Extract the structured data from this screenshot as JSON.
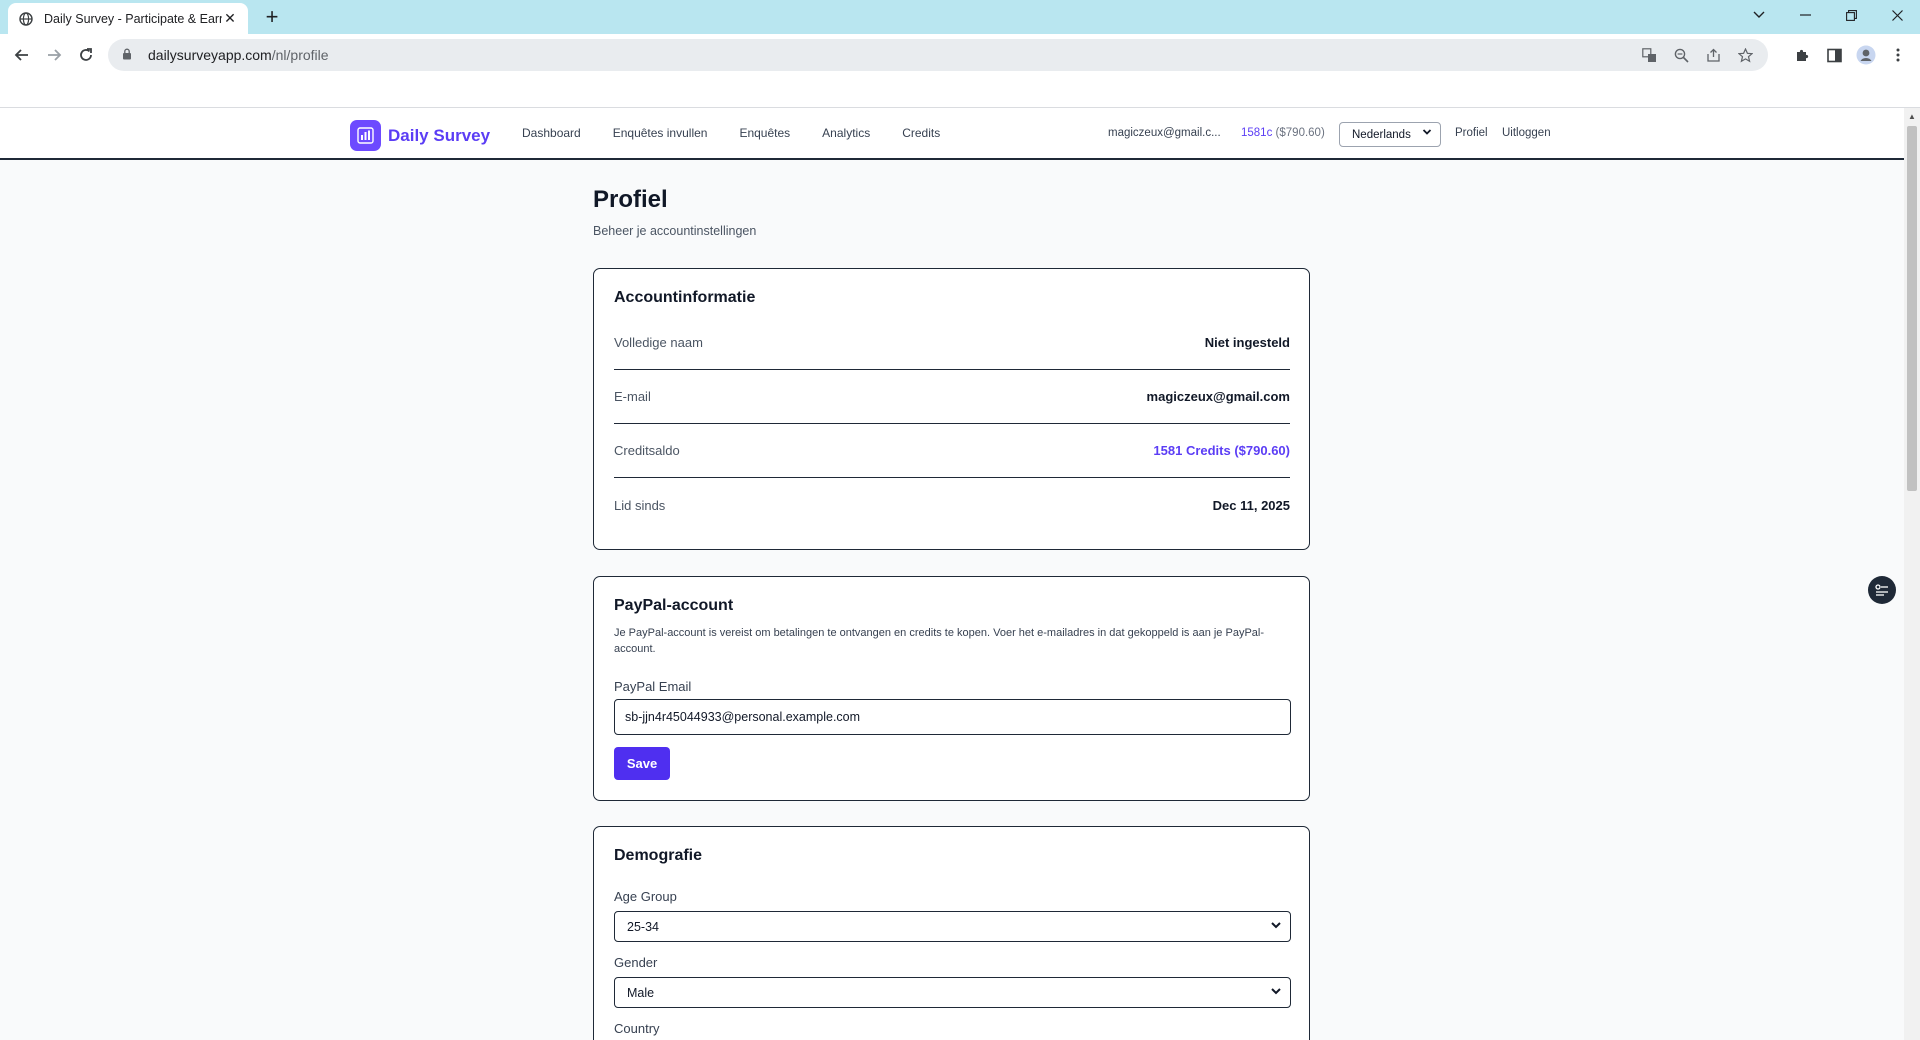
{
  "browser": {
    "tab_title": "Daily Survey - Participate & Earn",
    "tab_close": "✕",
    "new_tab": "+",
    "url_domain": "dailysurveyapp.com",
    "url_path": "/nl/profile"
  },
  "site": {
    "brand": "Daily Survey",
    "brand_color": "#5b3df5",
    "nav": [
      "Dashboard",
      "Enquêtes invullen",
      "Enquêtes",
      "Analytics",
      "Credits"
    ],
    "user_email": "magiczeux@gmail.c...",
    "credits_short": "1581c",
    "credits_usd": "($790.60)",
    "language": "Nederlands",
    "profile_link": "Profiel",
    "logout_link": "Uitloggen"
  },
  "page": {
    "title": "Profiel",
    "subtitle": "Beheer je accountinstellingen"
  },
  "account": {
    "title": "Accountinformatie",
    "rows": [
      {
        "label": "Volledige naam",
        "value": "Niet ingesteld"
      },
      {
        "label": "E-mail",
        "value": "magiczeux@gmail.com"
      },
      {
        "label": "Creditsaldo",
        "value": "1581 Credits ($790.60)"
      },
      {
        "label": "Lid sinds",
        "value": "Dec 11, 2025"
      }
    ]
  },
  "paypal": {
    "title": "PayPal-account",
    "description": "Je PayPal-account is vereist om betalingen te ontvangen en credits te kopen. Voer het e-mailadres in dat gekoppeld is aan je PayPal-account.",
    "email_label": "PayPal Email",
    "email_value": "sb-jjn4r45044933@personal.example.com",
    "save_label": "Save"
  },
  "demographics": {
    "title": "Demografie",
    "age_label": "Age Group",
    "age_value": "25-34",
    "gender_label": "Gender",
    "gender_value": "Male",
    "country_label": "Country"
  }
}
